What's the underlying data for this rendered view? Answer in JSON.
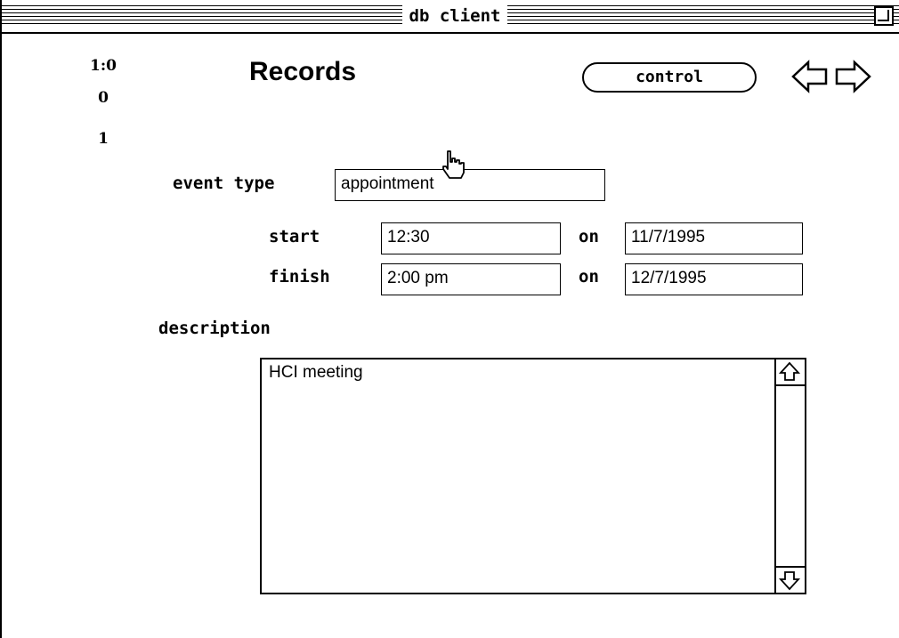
{
  "window": {
    "title": "db client"
  },
  "counter": {
    "line1": "1:0",
    "line2": "0",
    "line3": "1"
  },
  "page": {
    "heading": "Records"
  },
  "toolbar": {
    "control_label": "control"
  },
  "form": {
    "event_type_label": "event type",
    "event_type_value": "appointment",
    "start_label": "start",
    "start_time": "12:30",
    "start_on_label": "on",
    "start_date": "11/7/1995",
    "finish_label": "finish",
    "finish_time": "2:00 pm",
    "finish_on_label": "on",
    "finish_date": "12/7/1995",
    "description_label": "description",
    "description_value": "HCI meeting"
  },
  "icons": {
    "back": "left-arrow-icon",
    "forward": "right-arrow-icon",
    "scroll_up": "scroll-up-arrow-icon",
    "scroll_down": "scroll-down-arrow-icon",
    "pointer": "hand-pointer-icon",
    "zoom": "zoom-box-icon"
  }
}
